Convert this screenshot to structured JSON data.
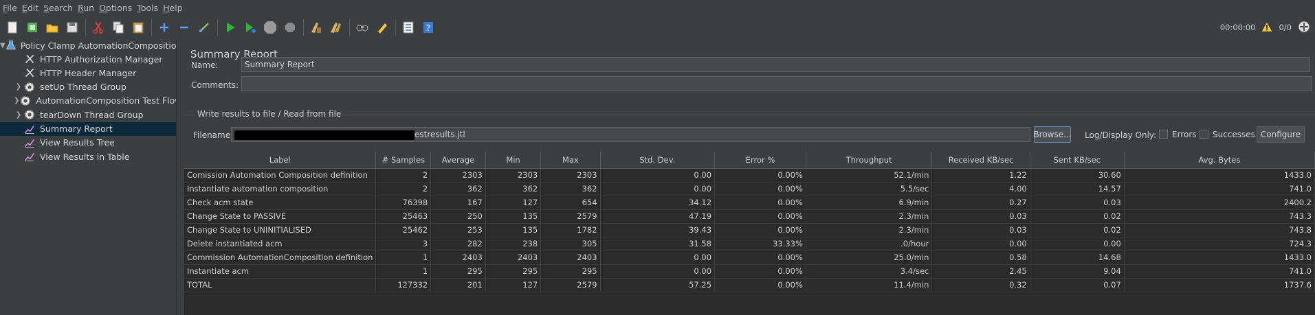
{
  "menu": [
    {
      "pre": "",
      "u": "F",
      "post": "ile"
    },
    {
      "pre": "",
      "u": "E",
      "post": "dit"
    },
    {
      "pre": "",
      "u": "S",
      "post": "earch"
    },
    {
      "pre": "",
      "u": "R",
      "post": "un"
    },
    {
      "pre": "",
      "u": "O",
      "post": "ptions"
    },
    {
      "pre": "",
      "u": "T",
      "post": "ools"
    },
    {
      "pre": "",
      "u": "H",
      "post": "elp"
    }
  ],
  "toolbar_right": {
    "timer": "00:00:00",
    "warning_count": "",
    "threads": "0/0"
  },
  "tree": {
    "root": "Policy Clamp AutomationComposition P",
    "items": [
      {
        "label": "HTTP Authorization Manager",
        "icon": "wrench-icon",
        "expandable": false
      },
      {
        "label": "HTTP Header Manager",
        "icon": "wrench-icon",
        "expandable": false
      },
      {
        "label": "setUp Thread Group",
        "icon": "gear-icon",
        "expandable": true
      },
      {
        "label": "AutomationComposition Test Flow",
        "icon": "gear-icon",
        "expandable": true
      },
      {
        "label": "tearDown Thread Group",
        "icon": "gear-icon",
        "expandable": true
      },
      {
        "label": "Summary Report",
        "icon": "chart-icon",
        "expandable": false,
        "selected": true
      },
      {
        "label": "View Results Tree",
        "icon": "chart-icon",
        "expandable": false
      },
      {
        "label": "View Results in Table",
        "icon": "chart-icon",
        "expandable": false
      }
    ]
  },
  "panel": {
    "title": "Summary Report",
    "name_label": "Name:",
    "name_value": "Summary Report",
    "comments_label": "Comments:",
    "comments_value": "",
    "file_section_label": "Write results to file / Read from file",
    "filename_label": "Filename",
    "filename_suffix": "estresults.jtl",
    "browse_label": "Browse...",
    "log_display_label": "Log/Display Only:",
    "errors_label": "Errors",
    "successes_label": "Successes",
    "configure_label": "Configure"
  },
  "table": {
    "columns": [
      "Label",
      "# Samples",
      "Average",
      "Min",
      "Max",
      "Std. Dev.",
      "Error %",
      "Throughput",
      "Received KB/sec",
      "Sent KB/sec",
      "Avg. Bytes"
    ],
    "rows": [
      [
        "Comission Automation Composition definition",
        "2",
        "2303",
        "2303",
        "2303",
        "0.00",
        "0.00%",
        "52.1/min",
        "1.22",
        "30.60",
        "1433.0"
      ],
      [
        "Instantiate automation composition",
        "2",
        "362",
        "362",
        "362",
        "0.00",
        "0.00%",
        "5.5/sec",
        "4.00",
        "14.57",
        "741.0"
      ],
      [
        "Check acm state",
        "76398",
        "167",
        "127",
        "654",
        "34.12",
        "0.00%",
        "6.9/min",
        "0.27",
        "0.03",
        "2400.2"
      ],
      [
        "Change State to PASSIVE",
        "25463",
        "250",
        "135",
        "2579",
        "47.19",
        "0.00%",
        "2.3/min",
        "0.03",
        "0.02",
        "743.3"
      ],
      [
        "Change State to UNINITIALISED",
        "25462",
        "253",
        "135",
        "1782",
        "39.43",
        "0.00%",
        "2.3/min",
        "0.03",
        "0.02",
        "743.8"
      ],
      [
        "Delete instantiated acm",
        "3",
        "282",
        "238",
        "305",
        "31.58",
        "33.33%",
        ".0/hour",
        "0.00",
        "0.00",
        "724.3"
      ],
      [
        "Commission AutomationComposition definition",
        "1",
        "2403",
        "2403",
        "2403",
        "0.00",
        "0.00%",
        "25.0/min",
        "0.58",
        "14.68",
        "1433.0"
      ],
      [
        "Instantiate acm",
        "1",
        "295",
        "295",
        "295",
        "0.00",
        "0.00%",
        "3.4/sec",
        "2.45",
        "9.04",
        "741.0"
      ],
      [
        "TOTAL",
        "127332",
        "201",
        "127",
        "2579",
        "57.25",
        "0.00%",
        "11.4/min",
        "0.32",
        "0.07",
        "1737.6"
      ]
    ]
  }
}
